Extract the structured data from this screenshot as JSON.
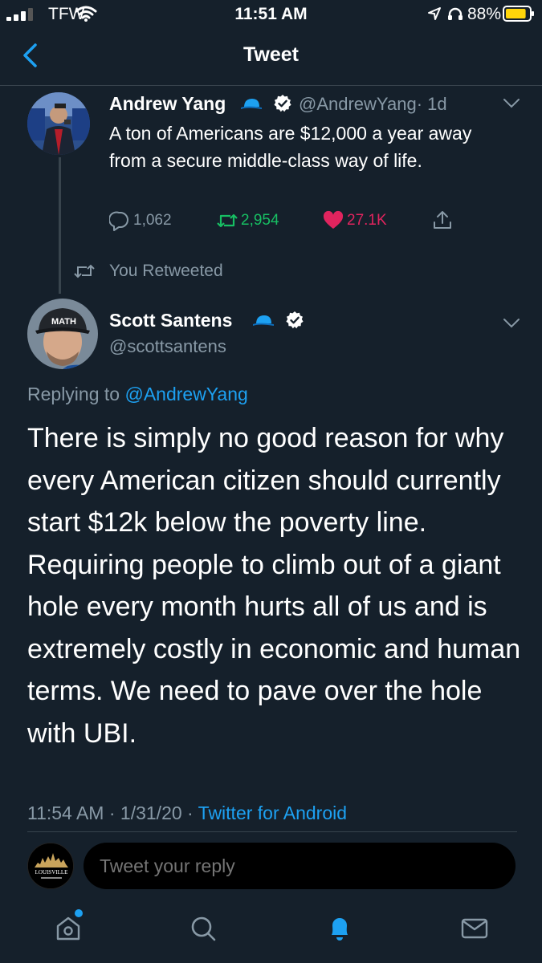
{
  "status_bar": {
    "carrier": "TFW",
    "time": "11:51 AM",
    "battery": "88%",
    "battery_level": 0.88
  },
  "nav": {
    "title": "Tweet"
  },
  "parent_tweet": {
    "name": "Andrew Yang",
    "handle": "@AndrewYang",
    "age": "· 1d",
    "text": "A ton of Americans are $12,000 a year away from a secure middle-class way of life.",
    "replies": "1,062",
    "retweets": "2,954",
    "likes": "27.1K"
  },
  "retweet_note": "You Retweeted",
  "main_tweet": {
    "name": "Scott Santens",
    "handle": "@scottsantens",
    "replying_prefix": "Replying to ",
    "replying_to": "@AndrewYang",
    "text": "There is simply no good reason for why every American citizen should currently start $12k below the poverty line. Requiring people to climb out of a giant hole every month hurts all of us and is extremely costly in economic and human terms. We need to pave over the hole with UBI.",
    "timestamp": "11:54 AM · 1/31/20 · ",
    "source": "Twitter for Android"
  },
  "reply_bar": {
    "avatar_text": "LOUISVILLE",
    "placeholder": "Tweet your reply"
  },
  "colors": {
    "background": "#15202b",
    "accent": "#1da1f2",
    "retweet": "#17bf63",
    "like": "#e0245e",
    "muted": "#8899a6",
    "battery": "#ffd60a"
  }
}
